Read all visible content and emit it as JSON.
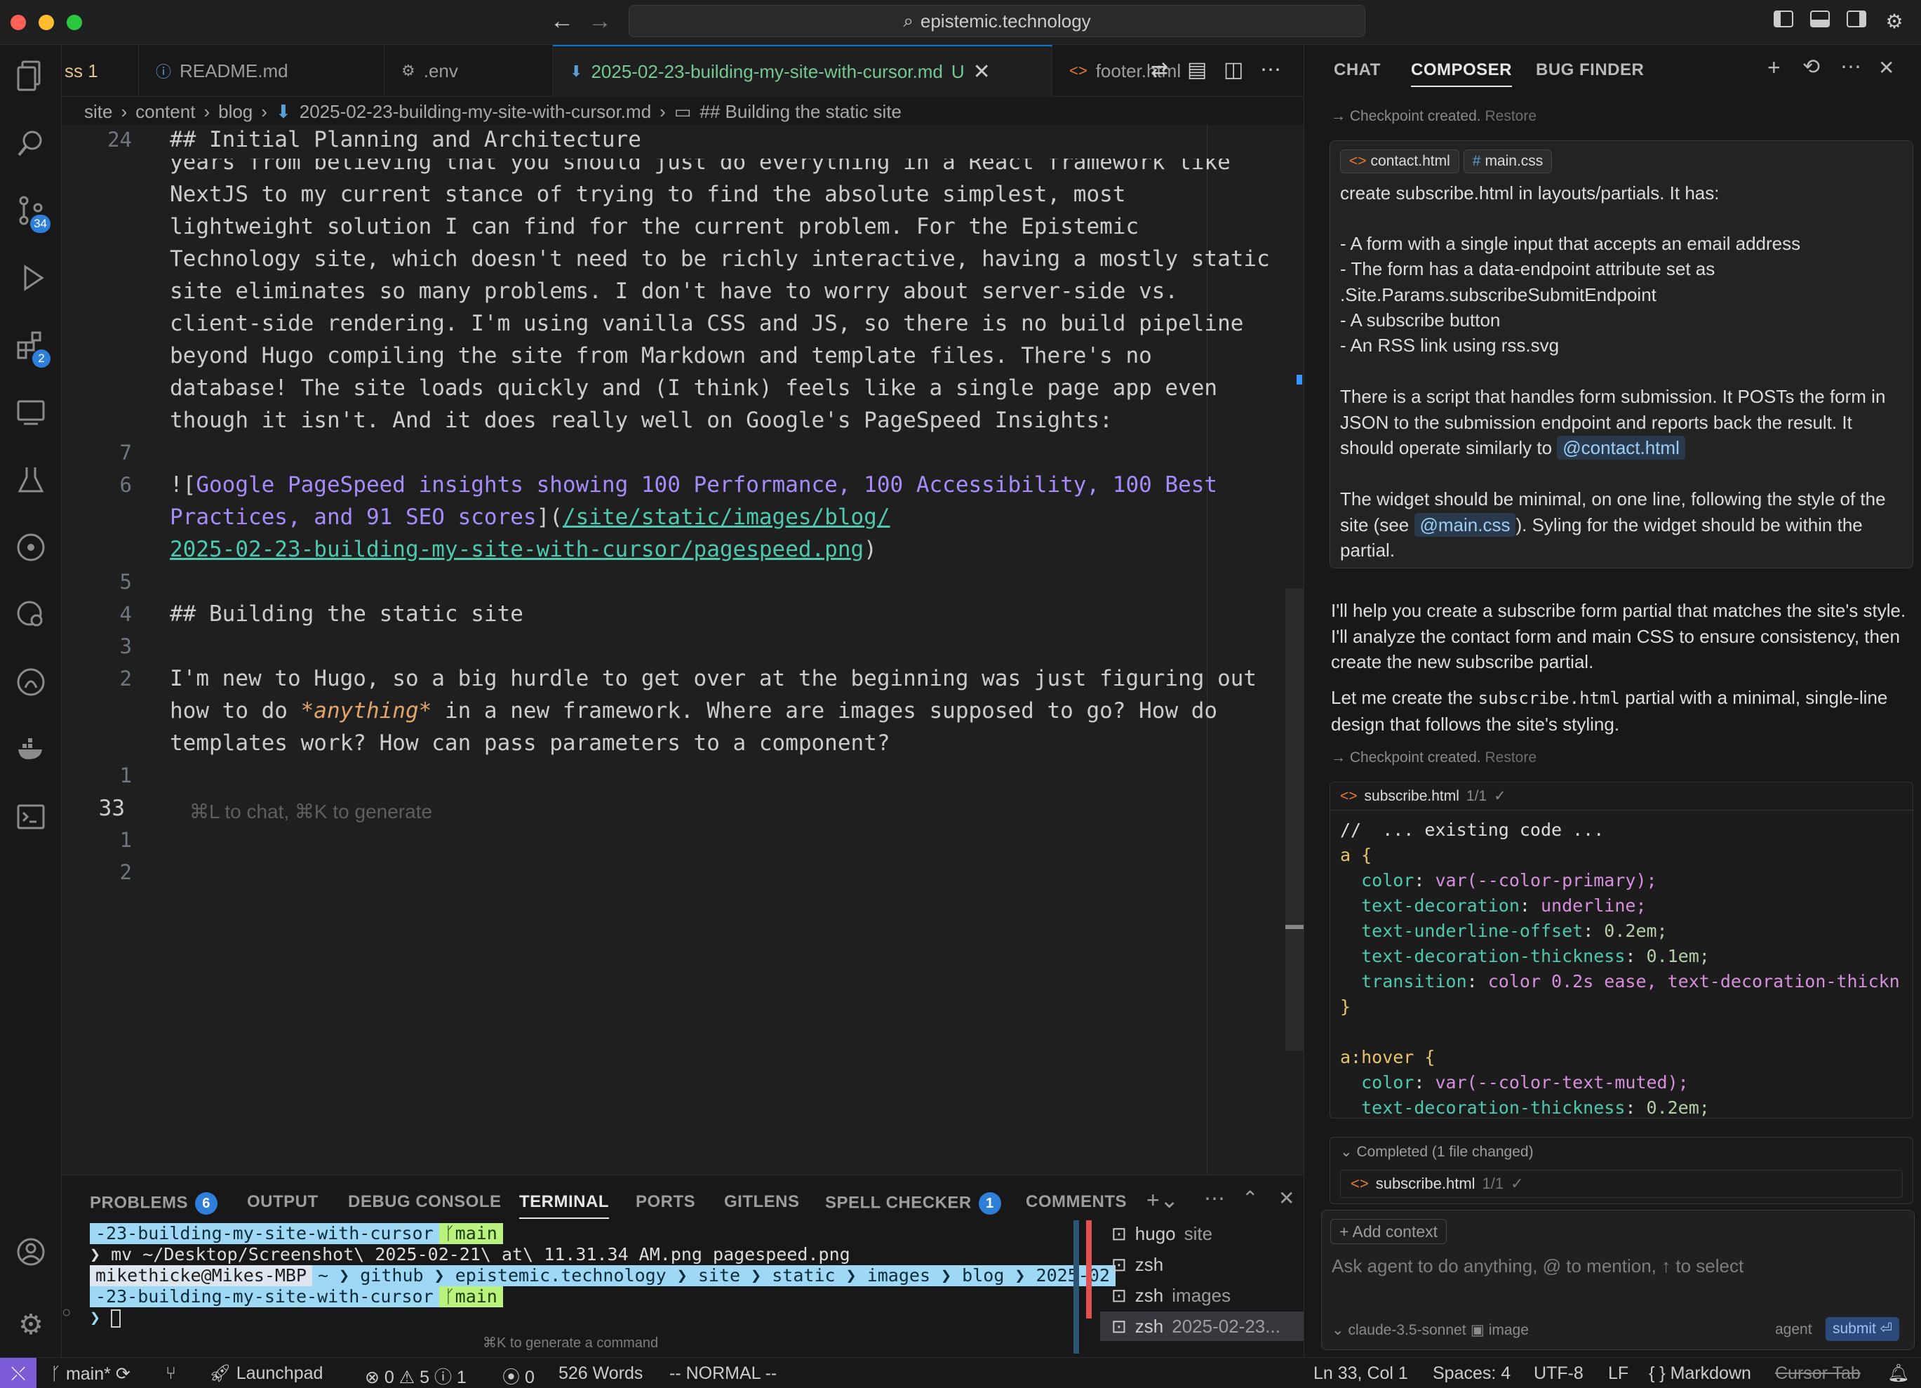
{
  "titlebar": {
    "title": "epistemic.technology",
    "search_icon": "⌕"
  },
  "tabs": [
    {
      "label": "ss 1"
    },
    {
      "icon": "ⓘ",
      "label": "README.md"
    },
    {
      "icon": "⚙",
      "label": ".env"
    },
    {
      "icon": "⬇",
      "label": "2025-02-23-building-my-site-with-cursor.md",
      "status": "U"
    },
    {
      "icon": "<>",
      "label": "footer.html"
    }
  ],
  "breadcrumb": [
    "site",
    "content",
    "blog",
    "2025-02-23-building-my-site-with-cursor.md",
    "## Building the static site"
  ],
  "editor": {
    "lines": [
      {
        "n": "24",
        "t": "## Initial Planning and Architecture"
      },
      {
        "n": "",
        "t": "years from believing that you should just do everything in a React framework like"
      },
      {
        "n": "",
        "t": "NextJS to my current stance of trying to find the absolute simplest, most"
      },
      {
        "n": "",
        "t": "lightweight solution I can find for the current problem. For the Epistemic"
      },
      {
        "n": "",
        "t": "Technology site, which doesn't need to be richly interactive, having a mostly static"
      },
      {
        "n": "",
        "t": "site eliminates so many problems. I don't have to worry about server-side vs."
      },
      {
        "n": "",
        "t": "client-side rendering. I'm using vanilla CSS and JS, so there is no build pipeline"
      },
      {
        "n": "",
        "t": "beyond Hugo compiling the site from Markdown and template files. There's no"
      },
      {
        "n": "",
        "t": "database! The site loads quickly and (I think) feels like a single page app even"
      },
      {
        "n": "",
        "t": "though it isn't. And it does really well on Google's PageSpeed Insights:"
      }
    ],
    "ln7": "7",
    "ln6": "6",
    "ln5": "5",
    "ln4": "4",
    "ln3": "3",
    "ln2": "2",
    "ln1": "1",
    "ln33": "33",
    "ln1b": "1",
    "ln2b": "2",
    "img_alt_open": "![",
    "img_alt_1": "Google PageSpeed insights showing 100 Performance, 100 Accessibility, 100 Best",
    "img_alt_2": "Practices, and 91 SEO scores",
    "img_mid": "](",
    "img_url_1": "/site/static/images/blog/",
    "img_url_2": "2025-02-23-building-my-site-with-cursor/pagespeed.png",
    "img_close": ")",
    "heading": "## Building the static site",
    "p1": "I'm new to Hugo, so a big hurdle to get over at the beginning was just figuring out",
    "p2a": "how to do ",
    "p2em": "*anything*",
    "p2b": " in a new framework. Where are images supposed to go? How do",
    "p3": "templates work? How can pass parameters to a component?",
    "hint": "⌘L to chat, ⌘K to generate"
  },
  "panel": {
    "tabs": [
      {
        "label": "PROBLEMS",
        "badge": "6"
      },
      {
        "label": "OUTPUT"
      },
      {
        "label": "DEBUG CONSOLE"
      },
      {
        "label": "TERMINAL"
      },
      {
        "label": "PORTS"
      },
      {
        "label": "GITLENS"
      },
      {
        "label": "SPELL CHECKER",
        "badge": "1"
      },
      {
        "label": "COMMENTS"
      }
    ],
    "term": {
      "l1_dir": "-23-building-my-site-with-cursor",
      "l1_git": "ᚴmain",
      "l2": "❯ mv ~/Desktop/Screenshot\\ 2025-02-21\\ at\\ 11.31.34 AM.png pagespeed.png",
      "l3_user": "mikethicke@Mikes-MBP",
      "l3_path": "~ ❯ github ❯ epistemic.technology ❯ site ❯ static ❯ images ❯ blog ❯ 2025-02",
      "l4_dir": "-23-building-my-site-with-cursor",
      "l4_git": "ᚴmain",
      "l5": "❯",
      "hint": "⌘K to generate a command"
    },
    "terminals": [
      {
        "name": "hugo",
        "sub": "site"
      },
      {
        "name": "zsh",
        "sub": ""
      },
      {
        "name": "zsh",
        "sub": "images"
      },
      {
        "name": "zsh",
        "sub": "2025-02-23..."
      }
    ]
  },
  "chat": {
    "tabs": [
      "CHAT",
      "COMPOSER",
      "BUG FINDER"
    ],
    "checkpoint": "Checkpoint created.",
    "restore": "Restore",
    "ctx1": "contact.html",
    "ctx2": "main.css",
    "u1": "create subscribe.html in layouts/partials. It has:",
    "u2": "- A form with a single input that accepts an email address",
    "u3": "- The form has a data-endpoint attribute set as .Site.Params.subscribeSubmitEndpoint",
    "u4": "- A subscribe button",
    "u5": "- An RSS link using rss.svg",
    "u6a": "There is a script that handles form submission. It POSTs the form in JSON to the submission endpoint and reports back the result. It should operate similarly to",
    "u6chip": "@contact.html",
    "u7a": "The widget should be minimal, on one line, following the style of the site (see",
    "u7chip": "@main.css",
    "u7b": "). Syling for the widget should be within the partial.",
    "a1": "I'll help you create a subscribe form partial that matches the site's style. I'll analyze the contact form and main CSS to ensure consistency, then create the new subscribe partial.",
    "a2a": "Let me create the",
    "a2code": "subscribe.html",
    "a2b": "partial with a minimal, single-line design that follows the site's styling.",
    "file": "subscribe.html",
    "filecount": "1/1",
    "code": {
      "c1": "//  ... existing code ...",
      "c2sel": "a",
      "c2b": " {",
      "p1": "color",
      "v1": "var(--color-primary);",
      "p2": "text-decoration",
      "v2": "underline;",
      "p3": "text-underline-offset",
      "v3": "0.2em;",
      "p4": "text-decoration-thickness",
      "v4": "0.1em;",
      "p5": "transition",
      "v5": "color 0.2s ease, text-decoration-thickn",
      "c8": "}",
      "c10sel": "a:hover",
      "c10b": " {",
      "p6": "color",
      "v6": "var(--color-text-muted);",
      "p7": "text-decoration-thickness",
      "v7": "0.2em;"
    },
    "completed": "Completed (1 file changed)",
    "add_context": "+ Add context",
    "placeholder": "Ask agent to do anything, @ to mention, ↑ to select",
    "model": "claude-3.5-sonnet",
    "image": "image",
    "agent": "agent",
    "submit": "submit ⏎"
  },
  "status": {
    "branch": "main*",
    "launchpad": "Launchpad",
    "problems": "⊗ 0 ⚠ 5 ⓘ 1",
    "ports": "0",
    "words": "526 Words",
    "mode": "-- NORMAL --",
    "position": "Ln 33, Col 1",
    "spaces": "Spaces: 4",
    "encoding": "UTF-8",
    "eol": "LF",
    "language": "{ } Markdown",
    "cursor_tab": "Cursor Tab"
  },
  "colors": {
    "accent": "#0078d4",
    "badge": "#2e7fd9",
    "remote": "#7b5cd6"
  }
}
